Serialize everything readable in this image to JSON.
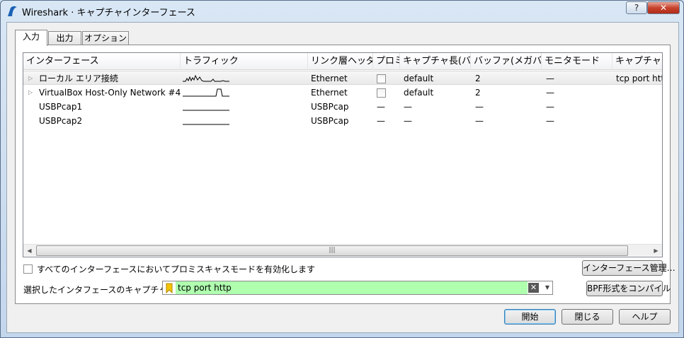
{
  "window": {
    "title": "Wireshark · キャプチャインターフェース",
    "help_label": "?",
    "close_label": "✕"
  },
  "tabs": [
    {
      "label": "入力"
    },
    {
      "label": "出力"
    },
    {
      "label": "オプション"
    }
  ],
  "table": {
    "columns": [
      "インターフェース",
      "トラフィック",
      "リンク層ヘッダ",
      "プロミ",
      "キャプチャ長(バ·",
      "バッファ(メガバ·",
      "モニタモード",
      "キャプチャフ"
    ],
    "rows": [
      {
        "name": "ローカル エリア接続",
        "expandable": true,
        "link": "Ethernet",
        "promisc": "checkbox",
        "snaplen": "default",
        "buffer": "2",
        "monitor": "—",
        "filter": "tcp port http",
        "selected": true,
        "sparkline": "activity"
      },
      {
        "name": "VirtualBox Host-Only Network #4",
        "expandable": true,
        "link": "Ethernet",
        "promisc": "checkbox",
        "snaplen": "default",
        "buffer": "2",
        "monitor": "—",
        "filter": "",
        "selected": false,
        "sparkline": "spike"
      },
      {
        "name": "USBPcap1",
        "expandable": false,
        "link": "USBPcap",
        "promisc": "—",
        "snaplen": "—",
        "buffer": "—",
        "monitor": "—",
        "filter": "",
        "selected": false,
        "sparkline": "flat"
      },
      {
        "name": "USBPcap2",
        "expandable": false,
        "link": "USBPcap",
        "promisc": "—",
        "snaplen": "—",
        "buffer": "—",
        "monitor": "—",
        "filter": "",
        "selected": false,
        "sparkline": "flat"
      }
    ]
  },
  "promisc_all_label": "すべてのインターフェースにおいてプロミスキャスモードを有効化します",
  "manage_interfaces_label": "インターフェース管理…",
  "capture_filter": {
    "label": "選択したインタフェースのキャプチャフィルタ:",
    "value": "tcp port http"
  },
  "compile_bpf_label": "BPF形式をコンパイル",
  "buttons": {
    "start": "開始",
    "close": "閉じる",
    "help": "ヘルプ"
  },
  "colors": {
    "filter_valid_bg": "#afffaf",
    "bookmark": "#f5c400"
  }
}
